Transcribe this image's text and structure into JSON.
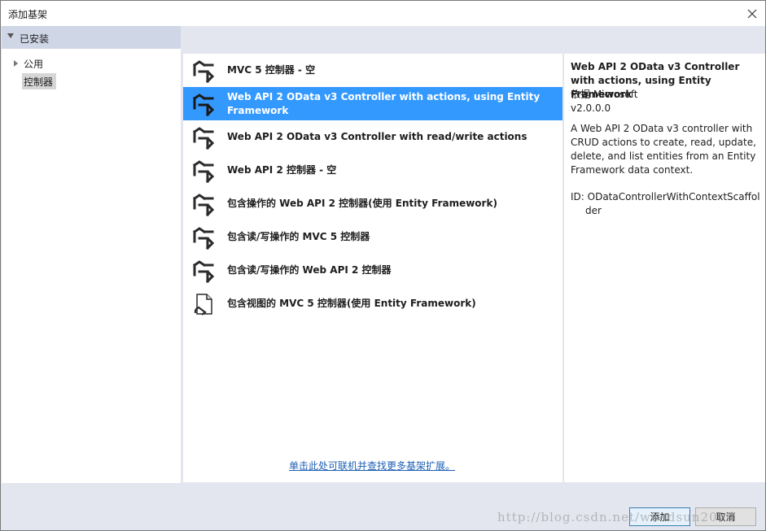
{
  "window": {
    "title": "添加基架"
  },
  "tree": {
    "installed_label": "已安装",
    "items": [
      {
        "label": "公用"
      },
      {
        "label": "控制器"
      }
    ]
  },
  "templates": [
    {
      "label": "MVC 5 控制器 - 空",
      "icon": "controller-icon",
      "selected": false
    },
    {
      "label": "Web API 2 OData v3 Controller with actions, using Entity Framework",
      "icon": "controller-icon",
      "selected": true
    },
    {
      "label": "Web API 2 OData v3 Controller with read/write actions",
      "icon": "controller-icon",
      "selected": false
    },
    {
      "label": "Web API 2 控制器 - 空",
      "icon": "controller-icon",
      "selected": false
    },
    {
      "label": "包含操作的 Web API 2 控制器(使用 Entity Framework)",
      "icon": "controller-icon",
      "selected": false
    },
    {
      "label": "包含读/写操作的 MVC 5 控制器",
      "icon": "controller-icon",
      "selected": false
    },
    {
      "label": "包含读/写操作的 Web API 2 控制器",
      "icon": "controller-icon",
      "selected": false
    },
    {
      "label": "包含视图的 MVC 5 控制器(使用 Entity Framework)",
      "icon": "document-controller-icon",
      "selected": false
    }
  ],
  "more_link": "单击此处可联机并查找更多基架扩展。",
  "detail": {
    "title": "Web API 2 OData v3 Controller with actions, using Entity Framework",
    "author": "依据 Microsoft",
    "version": "v2.0.0.0",
    "description": "A Web API 2 OData v3 controller with CRUD actions to create, read, update, delete, and list entities from an Entity Framework data context.",
    "id": "ID: ODataControllerWithContextScaffolder"
  },
  "buttons": {
    "add": "添加",
    "cancel": "取消"
  },
  "watermark": "http://blog.csdn.net/woodsun2008"
}
